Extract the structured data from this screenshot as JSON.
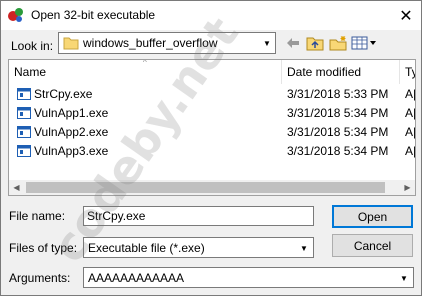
{
  "window": {
    "title": "Open 32-bit executable",
    "close_glyph": "✕"
  },
  "lookin": {
    "label": "Look in:",
    "value": "windows_buffer_overflow"
  },
  "toolbar": {
    "back_icon": "back-arrow-icon",
    "up_icon": "folder-up-icon",
    "new_folder_icon": "new-folder-icon",
    "view_icon": "view-menu-icon"
  },
  "filelist": {
    "columns": {
      "name": "Name",
      "date": "Date modified",
      "type": "Ty"
    },
    "rows": [
      {
        "name": "StrCpy.exe",
        "date": "3/31/2018 5:33 PM",
        "type": "A|"
      },
      {
        "name": "VulnApp1.exe",
        "date": "3/31/2018 5:34 PM",
        "type": "A|"
      },
      {
        "name": "VulnApp2.exe",
        "date": "3/31/2018 5:34 PM",
        "type": "A|"
      },
      {
        "name": "VulnApp3.exe",
        "date": "3/31/2018 5:34 PM",
        "type": "A|"
      }
    ]
  },
  "form": {
    "filename_label": "File name:",
    "filename_value": "StrCpy.exe",
    "filetype_label": "Files of type:",
    "filetype_value": "Executable file (*.exe)",
    "arguments_label": "Arguments:",
    "arguments_value": "AAAAAAAAAAAA"
  },
  "buttons": {
    "open": "Open",
    "cancel": "Cancel"
  },
  "watermark": {
    "text": "codeby.net"
  },
  "colors": {
    "accent": "#0078d7",
    "folder": "#f8d775",
    "exe_icon": "#1e5fb4"
  }
}
